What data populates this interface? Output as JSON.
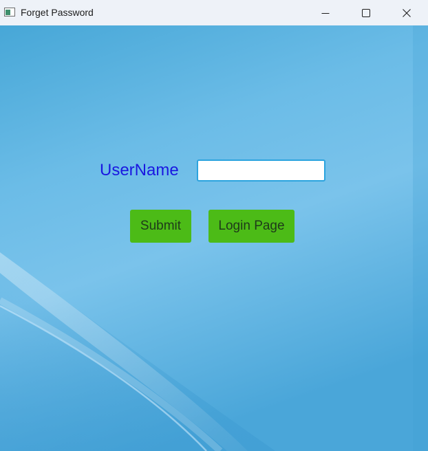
{
  "window": {
    "title": "Forget Password",
    "icon": "app-window-icon",
    "controls": {
      "minimize_icon": "minimize-icon",
      "maximize_icon": "maximize-icon",
      "close_icon": "close-icon"
    }
  },
  "form": {
    "username_label": "UserName",
    "username_value": "",
    "submit_label": "Submit",
    "login_page_label": "Login Page"
  },
  "colors": {
    "titlebar": "#eef2f8",
    "background": "#5fb3e0",
    "label": "#1a18e0",
    "button": "#4cbb17",
    "button_text": "#1e3a1a",
    "input_border": "#2ba3de"
  }
}
